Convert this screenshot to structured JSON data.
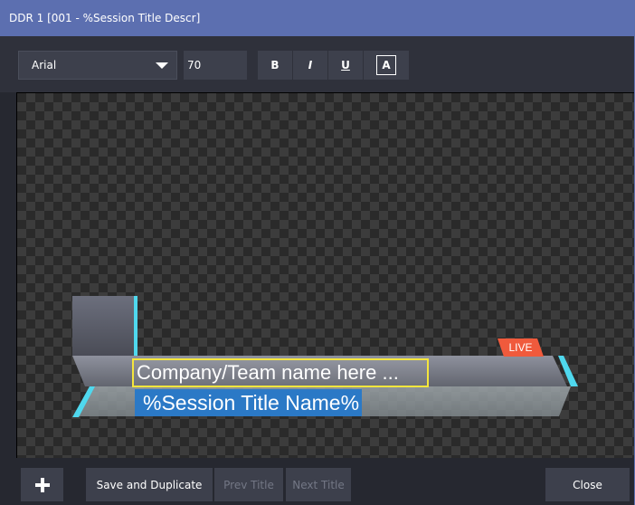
{
  "window": {
    "title": "DDR 1  [001 - %Session Title Descr]"
  },
  "toolbar": {
    "font_family_value": "Arial",
    "font_size_value": "70",
    "bold_label": "B",
    "italic_label": "I",
    "underline_label": "U",
    "text_color_label": "A"
  },
  "canvas": {
    "company_text": "Company/Team name here ...",
    "title_text": "%Session Title Name%",
    "live_badge": "LIVE"
  },
  "footer": {
    "add_icon": "+",
    "save_duplicate_label": "Save and Duplicate",
    "prev_title_label": "Prev Title",
    "next_title_label": "Next Title",
    "close_label": "Close"
  },
  "colors": {
    "titlebar": "#5c6fb0",
    "accent_cyan": "#4fd8ee",
    "live_red": "#f05a3c",
    "selection_blue": "#2b79c6",
    "focus_yellow": "#f5e63c"
  }
}
